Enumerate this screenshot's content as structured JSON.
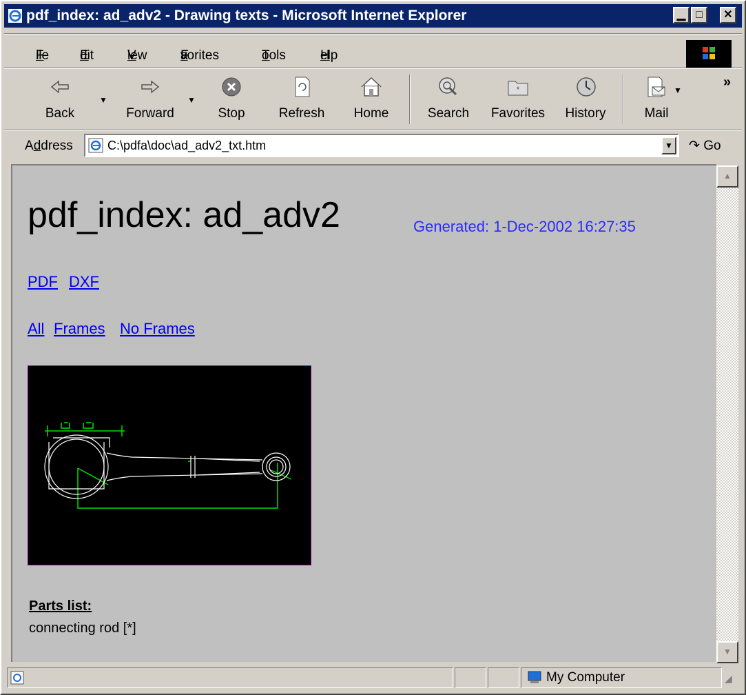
{
  "window": {
    "title": "pdf_index: ad_adv2 - Drawing texts - Microsoft Internet Explorer"
  },
  "menu": {
    "items": [
      {
        "label": "File",
        "key": "F",
        "rest": "ile"
      },
      {
        "label": "Edit",
        "key": "E",
        "rest": "dit"
      },
      {
        "label": "View",
        "key": "V",
        "rest": "iew"
      },
      {
        "label": "Favorites",
        "pre": "F",
        "key": "a",
        "rest": "vorites"
      },
      {
        "label": "Tools",
        "key": "T",
        "rest": "ools"
      },
      {
        "label": "Help",
        "key": "H",
        "rest": "elp"
      }
    ]
  },
  "toolbar": {
    "back": "Back",
    "forward": "Forward",
    "stop": "Stop",
    "refresh": "Refresh",
    "home": "Home",
    "search": "Search",
    "favorites": "Favorites",
    "history": "History",
    "mail": "Mail",
    "more": "»",
    "icons": [
      "back-arrow-icon",
      "forward-arrow-icon",
      "stop-icon",
      "refresh-icon",
      "home-icon",
      "search-icon",
      "favorites-icon",
      "history-icon",
      "mail-icon"
    ]
  },
  "address": {
    "label_key": "d",
    "label_pre": "A",
    "label_rest": "dress",
    "value": "C:\\pdfa\\doc\\ad_adv2_txt.htm",
    "go": "Go"
  },
  "page": {
    "heading": "pdf_index: ad_adv2",
    "generated": "Generated: 1-Dec-2002 16:27:35",
    "format_links": [
      "PDF",
      "DXF"
    ],
    "view_links": [
      "All",
      "Frames",
      "No Frames"
    ],
    "parts_heading": "Parts list:",
    "parts": [
      "connecting rod [*]"
    ]
  },
  "status": {
    "zone": "My Computer"
  },
  "colors": {
    "titlebar": "#0a246a",
    "content_bg": "#c0c0c0",
    "link": "#0000ee",
    "generated": "#2a2aff",
    "drawing_green": "#00e000"
  }
}
